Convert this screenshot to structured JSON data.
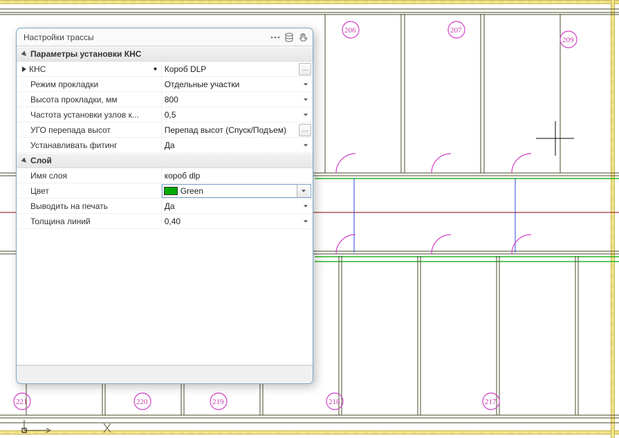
{
  "window": {
    "title": "Настройки трассы"
  },
  "groups": {
    "params_knc": {
      "header": "Параметры установки КНС"
    },
    "layer": {
      "header": "Слой"
    }
  },
  "rows": {
    "knc": {
      "label": "КНС",
      "value": "Короб DLP"
    },
    "lay_mode": {
      "label": "Режим прокладки",
      "value": "Отдельные участки"
    },
    "lay_height": {
      "label": "Высота прокладки, мм",
      "value": "800"
    },
    "node_freq": {
      "label": "Частота установки узлов к...",
      "value": "0,5"
    },
    "ugo_drop": {
      "label": "УГО перепада высот",
      "value": "Перепад высот (Спуск/Подъем)"
    },
    "install_fit": {
      "label": "Устанавливать фитинг",
      "value": "Да"
    },
    "layer_name": {
      "label": "Имя слоя",
      "value": "короб dlp"
    },
    "color": {
      "label": "Цвет",
      "value": "Green",
      "swatch": "#0a0"
    },
    "print": {
      "label": "Выводить на печать",
      "value": "Да"
    },
    "line_w": {
      "label": "Толщина линий",
      "value": "0,40"
    }
  },
  "room_labels": {
    "r206": "206",
    "r207": "207",
    "r209": "209",
    "r217": "217",
    "r218": "218",
    "r219": "219",
    "r220": "220",
    "r221": "221"
  }
}
